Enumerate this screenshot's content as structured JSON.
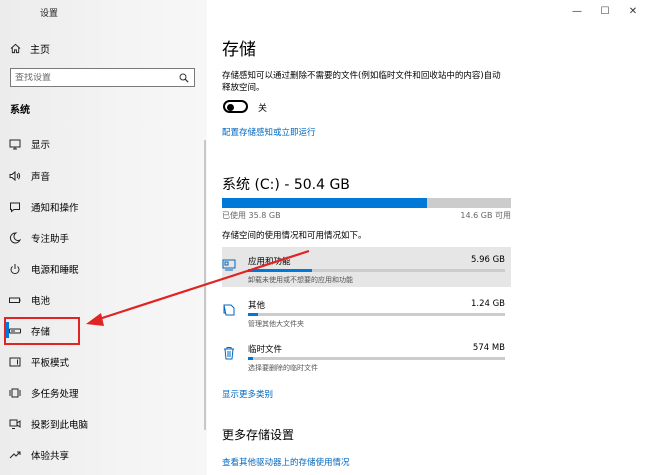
{
  "window": {
    "title": "设置",
    "minimize": "—",
    "maximize": "☐",
    "close": "✕"
  },
  "sidebar": {
    "home_label": "主页",
    "search_placeholder": "查找设置",
    "section_title": "系统",
    "items": [
      {
        "label": "显示",
        "icon": "display-icon"
      },
      {
        "label": "声音",
        "icon": "sound-icon"
      },
      {
        "label": "通知和操作",
        "icon": "notification-icon"
      },
      {
        "label": "专注助手",
        "icon": "moon-icon"
      },
      {
        "label": "电源和睡眠",
        "icon": "power-icon"
      },
      {
        "label": "电池",
        "icon": "battery-icon"
      },
      {
        "label": "存储",
        "icon": "storage-icon",
        "selected": true
      },
      {
        "label": "平板模式",
        "icon": "tablet-icon"
      },
      {
        "label": "多任务处理",
        "icon": "multitask-icon"
      },
      {
        "label": "投影到此电脑",
        "icon": "project-icon"
      },
      {
        "label": "体验共享",
        "icon": "share-icon"
      }
    ]
  },
  "main": {
    "title": "存储",
    "description": "存储感知可以通过删除不需要的文件(例如临时文件和回收站中的内容)自动释放空间。",
    "toggle_state": "关",
    "toggle_on": false,
    "configure_link": "配置存储感知或立即运行",
    "drive_title": "系统 (C:) - 50.4 GB",
    "used_label": "已使用 35.8 GB",
    "free_label": "14.6 GB 可用",
    "used_fraction": 0.71,
    "usage_desc": "存储空间的使用情况和可用情况如下。",
    "categories": [
      {
        "name": "应用和功能",
        "size": "5.96 GB",
        "sub": "卸载未使用或不想要的应用和功能",
        "fraction": 0.25,
        "icon": "apps-icon"
      },
      {
        "name": "其他",
        "size": "1.24 GB",
        "sub": "管理其他大文件夹",
        "fraction": 0.04,
        "icon": "other-icon"
      },
      {
        "name": "临时文件",
        "size": "574 MB",
        "sub": "选择要删除的临时文件",
        "fraction": 0.02,
        "icon": "trash-icon"
      }
    ],
    "more_link": "显示更多类别",
    "more_settings_title": "更多存储设置",
    "other_drives_link": "查看其他驱动器上的存储使用情况"
  },
  "colors": {
    "accent": "#0078d7",
    "annotation": "#e02323"
  }
}
